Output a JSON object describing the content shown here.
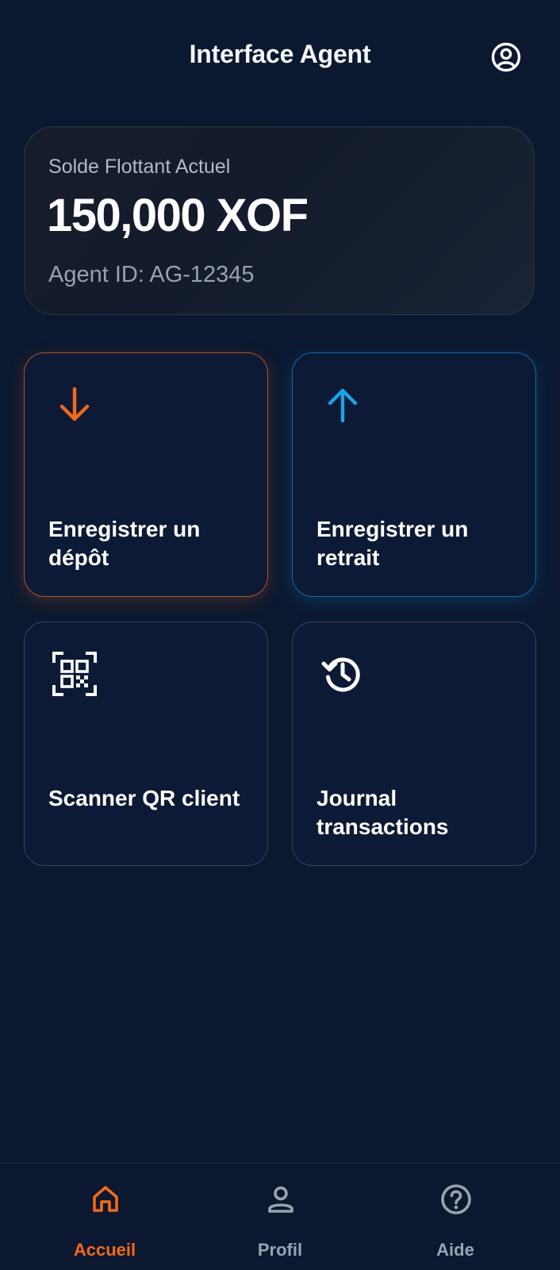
{
  "header": {
    "title": "Interface Agent",
    "profile_icon": "user-circle-icon"
  },
  "balance": {
    "label": "Solde Flottant Actuel",
    "amount": "150,000 XOF",
    "agent_id": "Agent ID: AG-12345"
  },
  "actions": [
    {
      "label": "Enregistrer un dépôt",
      "icon": "arrow-down-icon",
      "accent": "#f26a1b"
    },
    {
      "label": "Enregistrer un retrait",
      "icon": "arrow-up-icon",
      "accent": "#1aa3e8"
    },
    {
      "label": "Scanner QR client",
      "icon": "qr-code-icon",
      "accent": "#ffffff"
    },
    {
      "label": "Journal transactions",
      "icon": "history-icon",
      "accent": "#ffffff"
    }
  ],
  "bottom_nav": {
    "items": [
      {
        "label": "Accueil",
        "icon": "home-icon",
        "active": true
      },
      {
        "label": "Profil",
        "icon": "person-icon",
        "active": false
      },
      {
        "label": "Aide",
        "icon": "help-circle-icon",
        "active": false
      }
    ],
    "active_color": "#f26a1b",
    "inactive_color": "#9aa3b2"
  }
}
